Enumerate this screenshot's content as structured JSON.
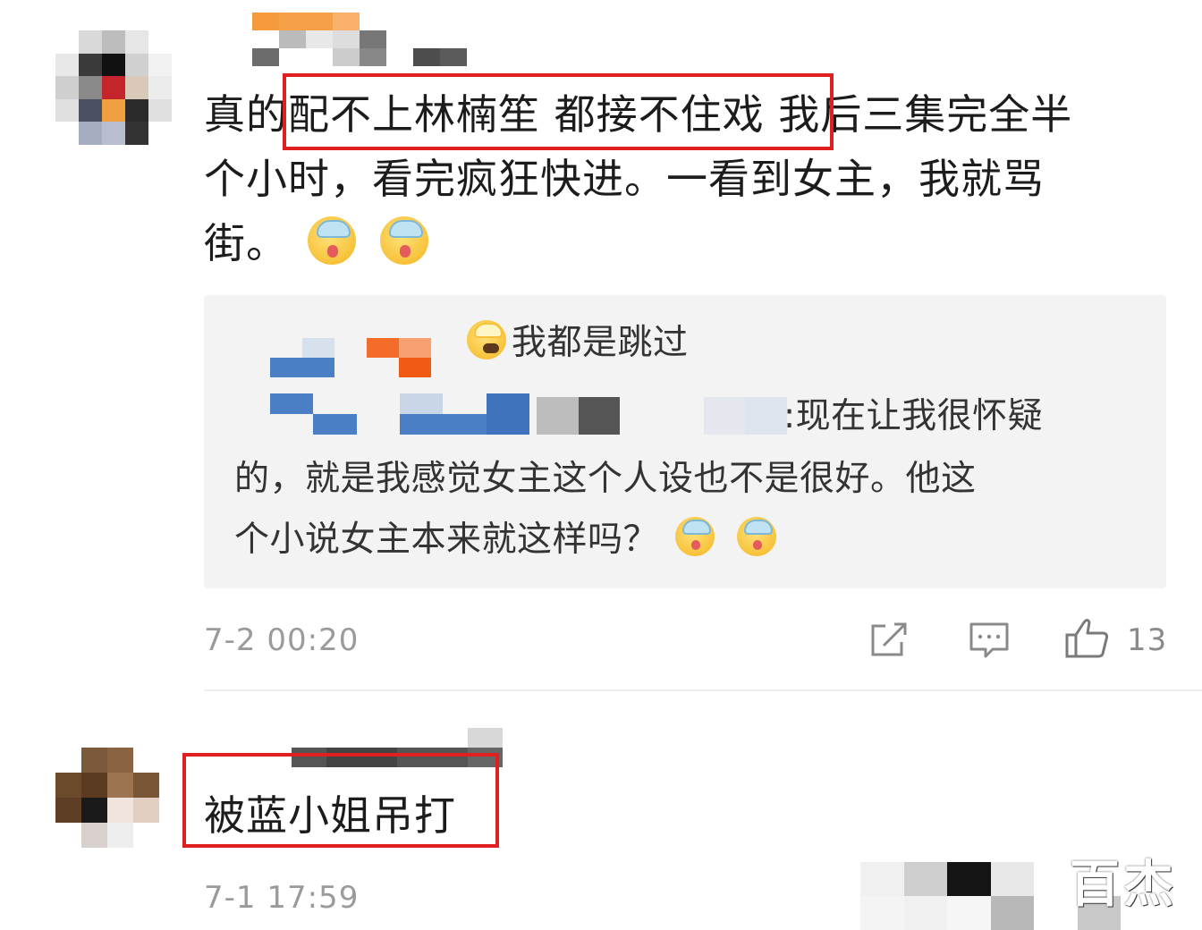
{
  "comments": [
    {
      "text_line1": "真的配不上林楠笙 都接不住戏 我后三集完全半",
      "text_line2": "个小时，看完疯狂快进。一看到女主，我就骂",
      "text_line3": "街。",
      "highlighted_phrase": "配不上林楠笙 都接不住戏",
      "reply": {
        "line1_tail": "我都是跳过",
        "line2_tail": ":现在让我很怀疑",
        "line3": "的，就是我感觉女主这个人设也不是很好。他这",
        "line4": "个小说女主本来就这样吗？"
      },
      "timestamp": "7-2 00:20",
      "actions": {
        "share_icon": "share-icon",
        "comment_icon": "comment-icon",
        "like_icon": "thumbs-up-icon",
        "like_count": "13"
      }
    },
    {
      "text": "被蓝小姐吊打",
      "timestamp": "7-1 17:59"
    }
  ],
  "watermark": "百杰",
  "colors": {
    "highlight_border": "#e02020",
    "reply_background": "#f3f3f3",
    "meta_text": "#9a9a9a"
  }
}
